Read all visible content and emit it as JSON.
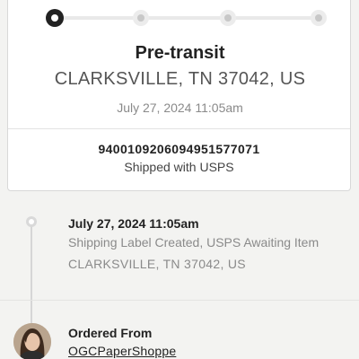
{
  "progress": {
    "steps": 4,
    "current_step": 1
  },
  "status": {
    "title": "Pre-transit",
    "location": "CLARKSVILLE, TN 37042, US",
    "date": "July 27, 2024 11:05am"
  },
  "shipment": {
    "tracking_number": "9400109206094951577071",
    "carrier_text": "Shipped with USPS"
  },
  "event": {
    "date": "July 27, 2024 11:05am",
    "description": "Shipping Label Created, USPS Awaiting Item",
    "location": "CLARKSVILLE, TN 37042, US"
  },
  "ordered_from": {
    "label": "Ordered From",
    "shop_name": "OGCPaperShoppe"
  },
  "colors": {
    "active_step": "#222222",
    "inactive_step": "#dcdcdc",
    "timeline": "#d6d6d6"
  }
}
